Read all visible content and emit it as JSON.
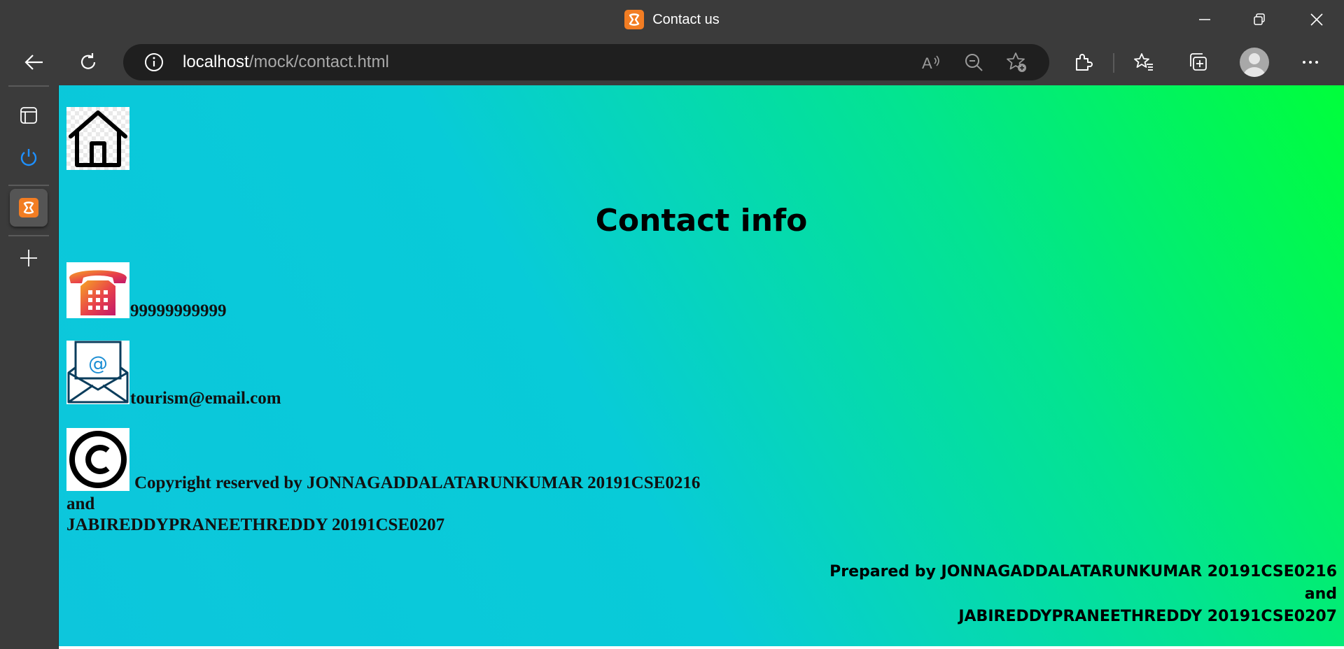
{
  "window": {
    "title": "Contact us",
    "app_icon": "xampp-icon",
    "controls": [
      "minimize-icon",
      "restore-icon",
      "close-icon"
    ]
  },
  "toolbar": {
    "url_host": "localhost",
    "url_path": "/mock/contact.html",
    "icons": [
      "back-icon",
      "refresh-icon",
      "site-info-icon",
      "read-aloud-icon",
      "zoom-out-icon",
      "add-favorite-icon",
      "extensions-icon",
      "favorites-icon",
      "collections-icon",
      "profile-avatar",
      "more-icon"
    ]
  },
  "sidebar": {
    "items": [
      "tab-actions-icon",
      "power-icon",
      "xampp-tab-icon",
      "add-icon"
    ]
  },
  "page": {
    "heading": "Contact info",
    "phone": "99999999999",
    "email": "tourism@email.com",
    "copyright_line1": "Copyright reserved by JONNAGADDALATARUNKUMAR 20191CSE0216",
    "copyright_line2": "and",
    "copyright_line3": "JABIREDDYPRANEETHREDDY 20191CSE0207",
    "prepared_line1": "Prepared by JONNAGADDALATARUNKUMAR 20191CSE0216",
    "prepared_line2": "and",
    "prepared_line3": "JABIREDDYPRANEETHREDDY 20191CSE0207"
  },
  "colors": {
    "chrome": "#3b3b3b",
    "gradient_start": "#0dc6dc",
    "gradient_end": "#00ff3a",
    "xampp_orange": "#f27d23"
  }
}
